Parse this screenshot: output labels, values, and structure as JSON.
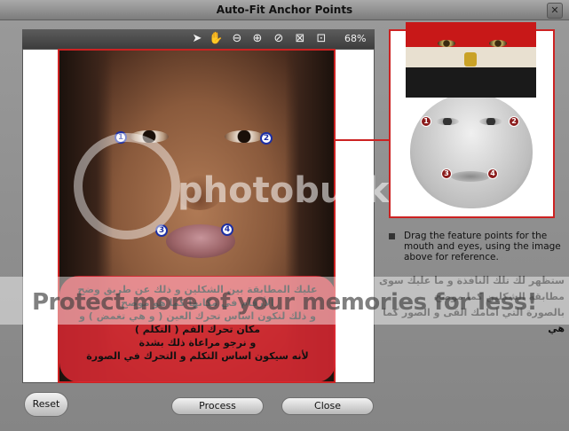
{
  "window": {
    "title": "Auto-Fit Anchor Points",
    "close_glyph": "✕"
  },
  "toolbar": {
    "icons": [
      "pointer-icon",
      "hand-icon",
      "zoom-out-icon",
      "zoom-in-icon",
      "no-entry-icon",
      "fit-window-icon",
      "fit-selection-icon"
    ],
    "glyphs": [
      "➤",
      "✋",
      "⊖",
      "⊕",
      "⊘",
      "⊠",
      "⊡"
    ],
    "zoom_label": "68%"
  },
  "photo": {
    "anchors": [
      "1",
      "2",
      "3",
      "4"
    ],
    "overlay_text_lines": [
      "عليك المطابقة بين الشكلين و ذلك عن طريق وضح",
      "الأرقام في مكانها كما هو موضح",
      "و ذلك لتكون اساس تحرك العين ( و هي تغمض ) و",
      "مكان تحرك الفم ( التكلم )",
      "و نرجو مراعاة ذلك بشدة",
      "لأنه سيكون اساس التكلم و التحرك في الصورة"
    ]
  },
  "reference": {
    "anchors": [
      "1",
      "2",
      "3",
      "4"
    ]
  },
  "instructions": "Drag the feature points for the mouth and eyes, using the image above for reference.",
  "arabic_right_lines": [
    "ستظهر لك تلك النافذة و ما عليك سوى",
    "مطابقة الشكلين كما موضح",
    "بالصورة التي امامك القى و الصور كما هي"
  ],
  "watermark": {
    "logo": "photobucket",
    "banner": "Protect more of your memories for less!"
  },
  "buttons": {
    "reset": "Reset",
    "process": "Process",
    "close": "Close"
  },
  "colors": {
    "accent_red": "#cc2222",
    "anchor_blue": "#1d2fa3",
    "ref_dot": "#8b1c1c"
  }
}
